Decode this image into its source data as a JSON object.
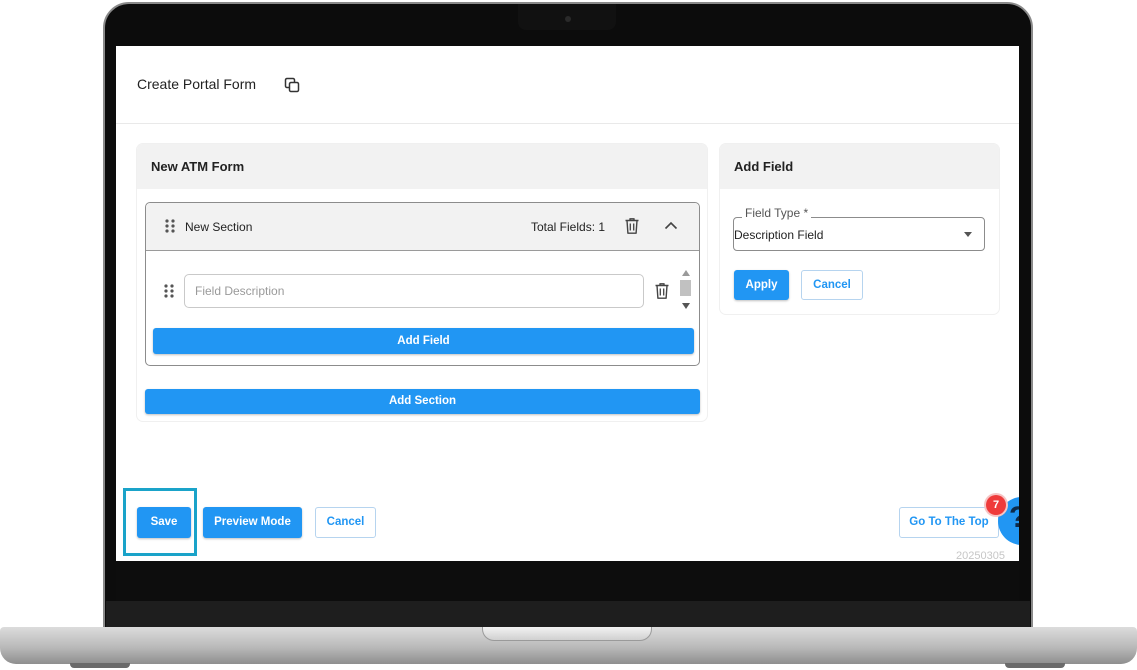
{
  "page": {
    "title": "Create Portal Form"
  },
  "form": {
    "name": "New ATM Form",
    "section": {
      "name": "New Section",
      "total_fields": "Total Fields: 1",
      "field_placeholder": "Field Description",
      "add_field_label": "Add Field"
    },
    "add_section_label": "Add Section"
  },
  "add_field_panel": {
    "title": "Add Field",
    "field_type_label": "Field Type *",
    "field_type_value": "Description Field",
    "apply_label": "Apply",
    "cancel_label": "Cancel"
  },
  "footer": {
    "save_label": "Save",
    "preview_label": "Preview Mode",
    "cancel_label": "Cancel",
    "go_top_label": "Go To The Top",
    "notification_count": "7",
    "help_label": "?",
    "version": "20250305"
  },
  "colors": {
    "primary": "#2196f3",
    "highlight": "#1aa3c9",
    "badge": "#ef3b3b"
  }
}
